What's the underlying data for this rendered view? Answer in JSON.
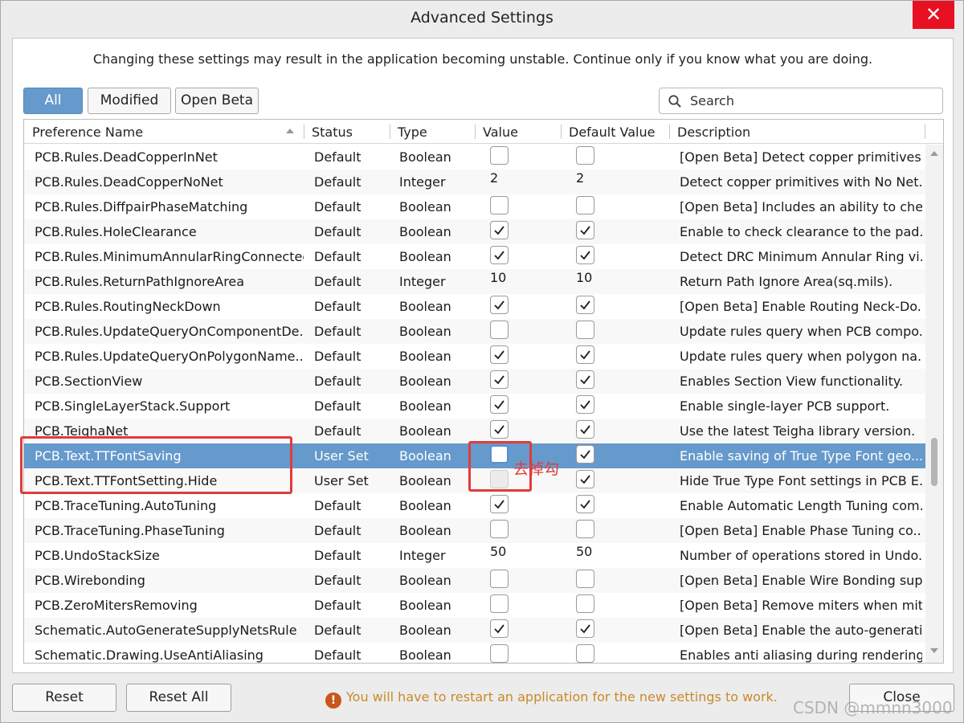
{
  "window": {
    "title": "Advanced Settings",
    "close_glyph": "✕"
  },
  "warning_text": "Changing these settings may result in the application becoming unstable. Continue only if you know what you are doing.",
  "filters": {
    "all": "All",
    "modified": "Modified",
    "open_beta": "Open Beta",
    "active": "All"
  },
  "search": {
    "placeholder": "Search"
  },
  "columns": {
    "name": "Preference Name",
    "status": "Status",
    "type": "Type",
    "value": "Value",
    "default": "Default Value",
    "description": "Description"
  },
  "rows": [
    {
      "name": "PCB.Rules.DeadCopperInNet",
      "status": "Default",
      "type": "Boolean",
      "value": false,
      "default": false,
      "desc": "[Open Beta] Detect copper primitives..."
    },
    {
      "name": "PCB.Rules.DeadCopperNoNet",
      "status": "Default",
      "type": "Integer",
      "value": "2",
      "default": "2",
      "desc": "Detect copper primitives with No Net..."
    },
    {
      "name": "PCB.Rules.DiffpairPhaseMatching",
      "status": "Default",
      "type": "Boolean",
      "value": false,
      "default": false,
      "desc": "[Open Beta] Includes an ability to che..."
    },
    {
      "name": "PCB.Rules.HoleClearance",
      "status": "Default",
      "type": "Boolean",
      "value": true,
      "default": true,
      "desc": "Enable to check clearance to the pad..."
    },
    {
      "name": "PCB.Rules.MinimumAnnularRingConnected",
      "status": "Default",
      "type": "Boolean",
      "value": true,
      "default": true,
      "desc": "Detect DRC Minimum Annular Ring vi..."
    },
    {
      "name": "PCB.Rules.ReturnPathIgnoreArea",
      "status": "Default",
      "type": "Integer",
      "value": "10",
      "default": "10",
      "desc": "Return Path Ignore Area(sq.mils)."
    },
    {
      "name": "PCB.Rules.RoutingNeckDown",
      "status": "Default",
      "type": "Boolean",
      "value": true,
      "default": true,
      "desc": "[Open Beta] Enable Routing Neck-Do..."
    },
    {
      "name": "PCB.Rules.UpdateQueryOnComponentDe...",
      "status": "Default",
      "type": "Boolean",
      "value": false,
      "default": false,
      "desc": "Update rules query when PCB compo..."
    },
    {
      "name": "PCB.Rules.UpdateQueryOnPolygonName...",
      "status": "Default",
      "type": "Boolean",
      "value": true,
      "default": true,
      "desc": "Update rules query when polygon na..."
    },
    {
      "name": "PCB.SectionView",
      "status": "Default",
      "type": "Boolean",
      "value": true,
      "default": true,
      "desc": "Enables Section View functionality."
    },
    {
      "name": "PCB.SingleLayerStack.Support",
      "status": "Default",
      "type": "Boolean",
      "value": true,
      "default": true,
      "desc": "Enable single-layer PCB support."
    },
    {
      "name": "PCB.TeighaNet",
      "status": "Default",
      "type": "Boolean",
      "value": true,
      "default": true,
      "desc": "Use the latest Teigha library version."
    },
    {
      "name": "PCB.Text.TTFontSaving",
      "status": "User Set",
      "type": "Boolean",
      "value": false,
      "default": true,
      "desc": "Enable saving of True Type Font geo...",
      "selected": true
    },
    {
      "name": "PCB.Text.TTFontSetting.Hide",
      "status": "User Set",
      "type": "Boolean",
      "value": false,
      "value_disabled": true,
      "default": true,
      "desc": "Hide True Type Font settings in PCB E..."
    },
    {
      "name": "PCB.TraceTuning.AutoTuning",
      "status": "Default",
      "type": "Boolean",
      "value": true,
      "default": true,
      "desc": "Enable Automatic Length Tuning com..."
    },
    {
      "name": "PCB.TraceTuning.PhaseTuning",
      "status": "Default",
      "type": "Boolean",
      "value": false,
      "default": false,
      "desc": "[Open Beta] Enable Phase Tuning co..."
    },
    {
      "name": "PCB.UndoStackSize",
      "status": "Default",
      "type": "Integer",
      "value": "50",
      "default": "50",
      "desc": "Number of operations stored in Undo..."
    },
    {
      "name": "PCB.Wirebonding",
      "status": "Default",
      "type": "Boolean",
      "value": false,
      "default": false,
      "desc": "[Open Beta] Enable Wire Bonding sup..."
    },
    {
      "name": "PCB.ZeroMitersRemoving",
      "status": "Default",
      "type": "Boolean",
      "value": false,
      "default": false,
      "desc": "[Open Beta] Remove miters when mit..."
    },
    {
      "name": "Schematic.AutoGenerateSupplyNetsRule",
      "status": "Default",
      "type": "Boolean",
      "value": true,
      "default": true,
      "desc": "[Open Beta] Enable the auto-generati..."
    },
    {
      "name": "Schematic.Drawing.UseAntiAliasing",
      "status": "Default",
      "type": "Boolean",
      "value": false,
      "default": false,
      "desc": "Enables anti aliasing during rendering."
    }
  ],
  "annotation": {
    "text": "去掉勾",
    "color": "#e23b3b"
  },
  "footer": {
    "reset": "Reset",
    "reset_all": "Reset All",
    "close": "Close",
    "restart_msg": "You will have to restart an application for the new settings to work.",
    "restart_icon": "!"
  },
  "watermark": "CSDN @mmnn3000",
  "colors": {
    "accent": "#6699cc",
    "close_red": "#e81123",
    "warning_orange": "#c98a2b"
  }
}
